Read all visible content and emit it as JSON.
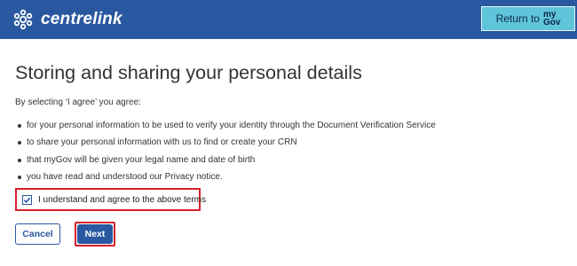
{
  "header": {
    "brand": "centrelink",
    "return_label": "Return to",
    "mygov_top": "my",
    "mygov_bottom": "Gov"
  },
  "page": {
    "title": "Storing and sharing your personal details",
    "intro": "By selecting ‘I agree’ you agree:",
    "bullets": [
      "for your personal information to be used to verify your identity through the Document Verification Service",
      "to share your personal information with us to find or create your CRN",
      "that myGov will be given your legal name and date of birth",
      "you have read and understood our Privacy notice."
    ]
  },
  "agreement": {
    "label": "I understand and agree to the above terms",
    "checked": true
  },
  "actions": {
    "cancel_label": "Cancel",
    "next_label": "Next"
  },
  "colors": {
    "header_bg": "#2a58a0",
    "return_button_bg": "#5fc5da",
    "highlight_outline": "#d6202a"
  }
}
